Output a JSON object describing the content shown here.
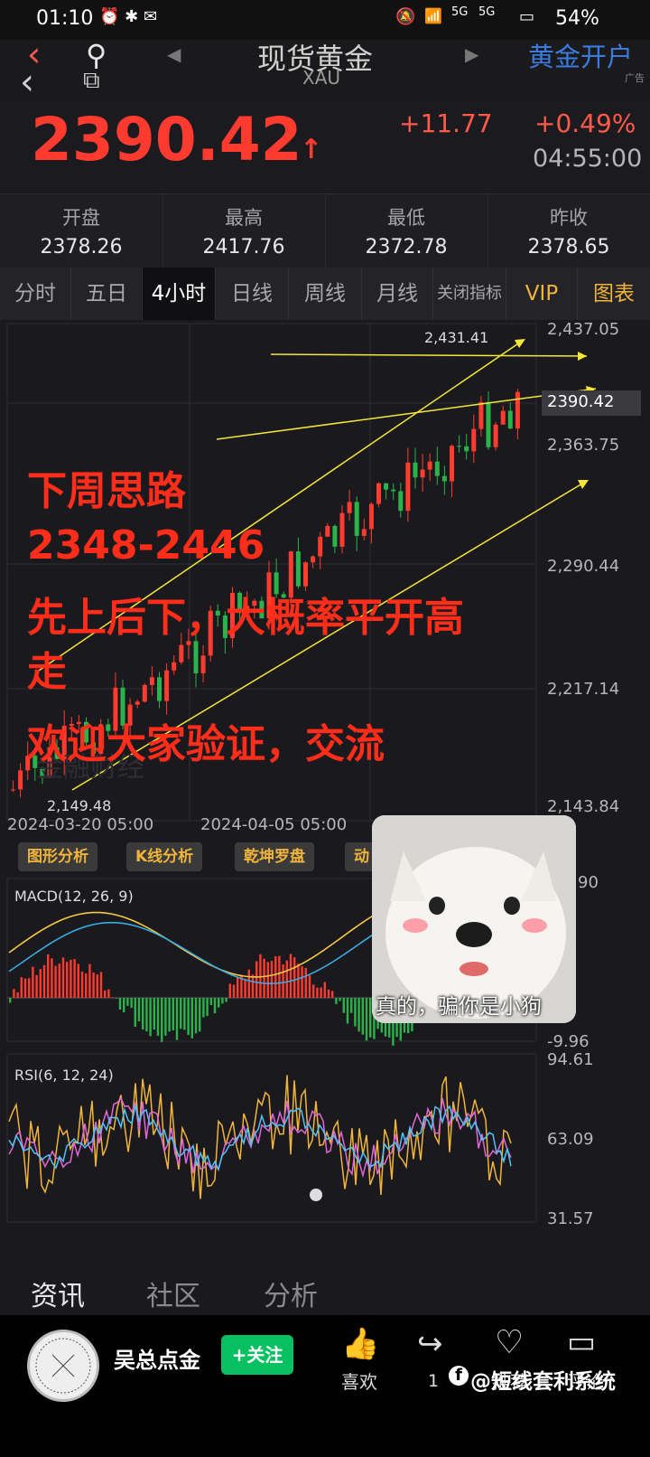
{
  "status": {
    "time": "01:10",
    "battery": "54%",
    "signal1": "5G",
    "signal2": "5G"
  },
  "header": {
    "title": "现货黄金",
    "subtitle": "XAU",
    "open_account": "黄金开户",
    "ad": "广告"
  },
  "price": {
    "last": "2390.42",
    "change": "+11.77",
    "change_pct": "+0.49%",
    "time": "04:55:00"
  },
  "ohlc": [
    {
      "label": "开盘",
      "value": "2378.26"
    },
    {
      "label": "最高",
      "value": "2417.76"
    },
    {
      "label": "最低",
      "value": "2372.78"
    },
    {
      "label": "昨收",
      "value": "2378.65"
    }
  ],
  "tabs": [
    "分时",
    "五日",
    "4小时",
    "日线",
    "周线",
    "月线",
    "关闭指标",
    "VIP",
    "图表"
  ],
  "chart": {
    "price_axis": [
      "2,437.05",
      "2,363.75",
      "2,290.44",
      "2,217.14",
      "2,143.84"
    ],
    "current_tag": "2390.42",
    "high_label": "2,431.41",
    "low_label": "2,149.48",
    "dates": [
      "2024-03-20 05:00",
      "2024-04-05 05:00"
    ],
    "watermark": "金融财经"
  },
  "overlay_text": [
    "下周思路",
    "2348-2446",
    "先上后下，大概率平开高",
    "走",
    "欢迎大家验证，交流"
  ],
  "tools": [
    "图形分析",
    "K线分析",
    "乾坤罗盘",
    "动"
  ],
  "macd": {
    "label": "MACD(12, 26, 9)",
    "top": "90",
    "bottom": "-9.96"
  },
  "rsi": {
    "label": "RSI(6, 12, 24)",
    "axis": [
      "94.61",
      "63.09",
      "31.57"
    ]
  },
  "sticker": {
    "caption": "真的，骗你是小狗"
  },
  "bottom_tabs": [
    "资讯",
    "社区",
    "分析"
  ],
  "author": {
    "name": "吴总点金",
    "follow": "+关注"
  },
  "actions": {
    "like": "喜欢",
    "share_count": "1",
    "recommend": "推荐",
    "comment": "评论"
  },
  "watermark_brand": "@短线套利系统",
  "colors": {
    "up": "#ff3b30",
    "down": "#29b34a",
    "gold": "#f0b43a",
    "line_yellow": "#f5e63a"
  }
}
